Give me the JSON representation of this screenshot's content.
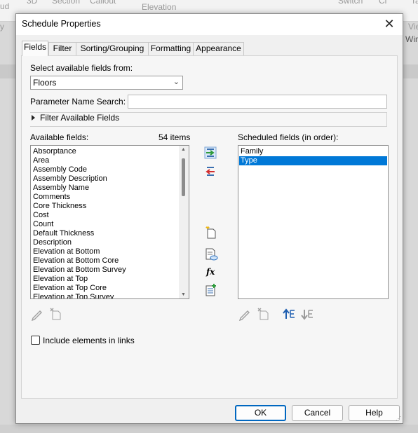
{
  "background_ribbon": {
    "items": [
      "ud",
      "3D",
      "Section",
      "Callout",
      "Elevation",
      "Switch",
      "Cl",
      "Ta",
      "Vie",
      "Win",
      "y"
    ]
  },
  "dialog": {
    "title": "Schedule Properties",
    "tabs": [
      "Fields",
      "Filter",
      "Sorting/Grouping",
      "Formatting",
      "Appearance"
    ],
    "active_tab": "Fields",
    "select_fields_label": "Select available fields from:",
    "select_fields_value": "Floors",
    "param_search_label": "Parameter Name Search:",
    "param_search_value": "",
    "filter_available_label": "Filter Available Fields",
    "available_fields_label": "Available fields:",
    "available_count": "54 items",
    "available_fields": [
      "Absorptance",
      "Area",
      "Assembly Code",
      "Assembly Description",
      "Assembly Name",
      "Comments",
      "Core Thickness",
      "Cost",
      "Count",
      "Default Thickness",
      "Description",
      "Elevation at Bottom",
      "Elevation at Bottom Core",
      "Elevation at Bottom Survey",
      "Elevation at Top",
      "Elevation at Top Core",
      "Elevation at Top Survey"
    ],
    "scheduled_fields_label": "Scheduled fields (in order):",
    "scheduled_fields": [
      "Family",
      "Type"
    ],
    "scheduled_selected": "Type",
    "include_links_label": "Include elements in links",
    "include_links_checked": false,
    "buttons": {
      "ok": "OK",
      "cancel": "Cancel",
      "help": "Help"
    },
    "icons": {
      "add": "add-field-arrow-icon",
      "remove": "remove-field-arrow-icon",
      "new_param": "new-parameter-icon",
      "combine": "combine-parameters-icon",
      "calculated": "calculated-value-icon",
      "add_all": "add-parameter-icon",
      "fx_symbol": "fx"
    },
    "colors": {
      "selection": "#0078d7",
      "default_button_border": "#0067c0"
    }
  }
}
